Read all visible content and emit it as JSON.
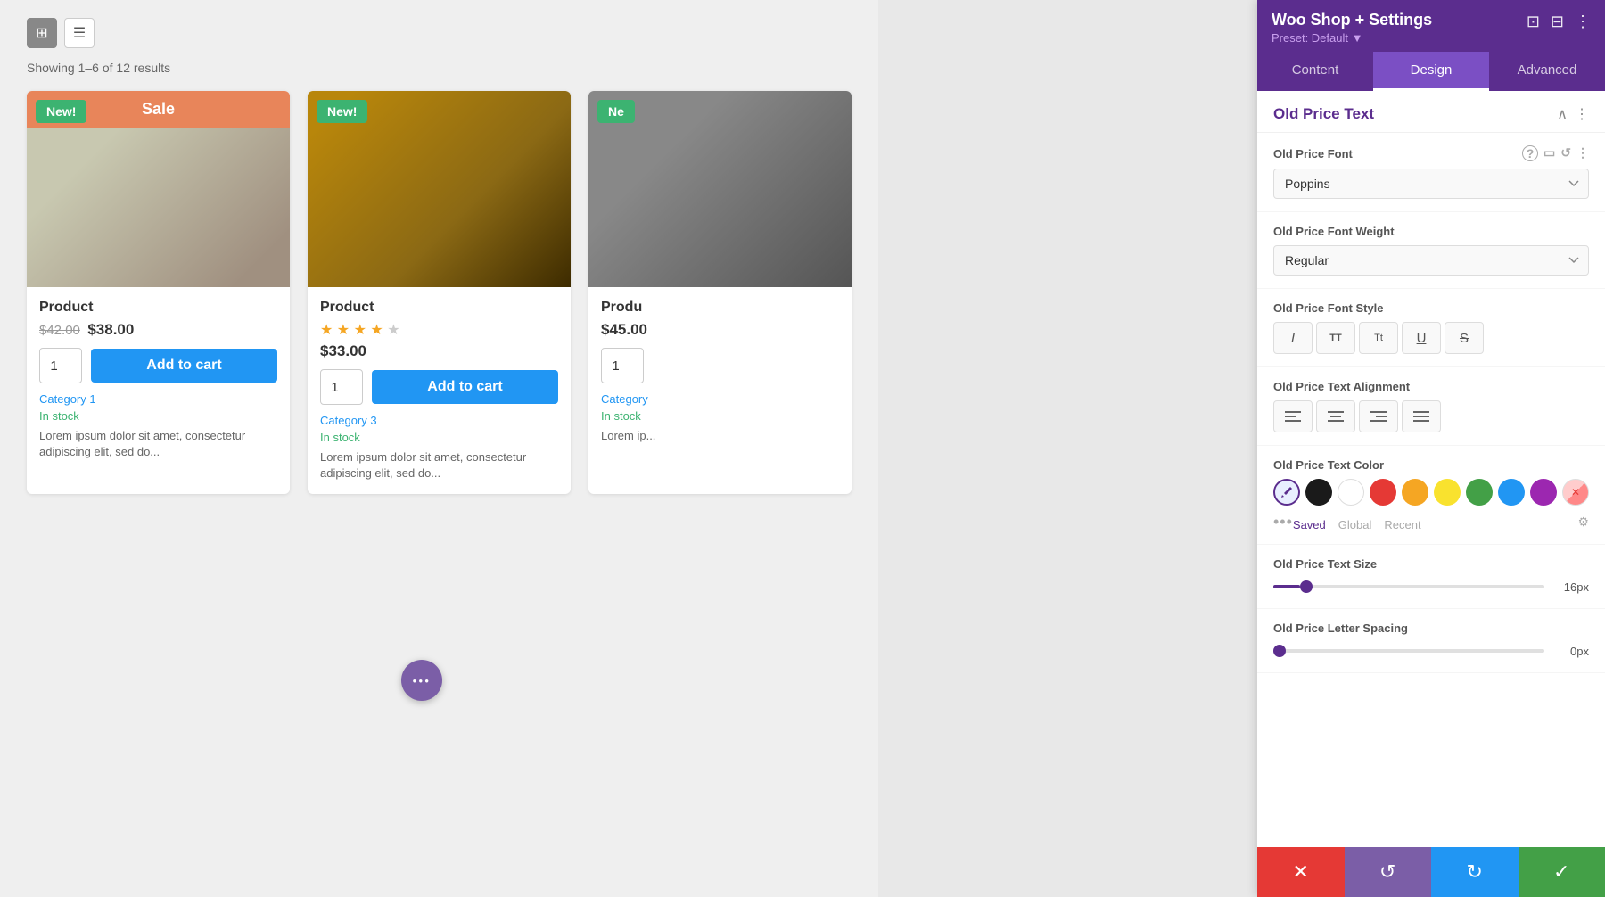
{
  "panel": {
    "title": "Woo Shop + Settings",
    "preset": "Preset: Default",
    "preset_arrow": "▼",
    "tabs": [
      {
        "id": "content",
        "label": "Content"
      },
      {
        "id": "design",
        "label": "Design"
      },
      {
        "id": "advanced",
        "label": "Advanced"
      }
    ],
    "active_tab": "design",
    "section": {
      "title": "Old Price Text"
    },
    "font": {
      "label": "Old Price Font",
      "value": "Poppins"
    },
    "font_weight": {
      "label": "Old Price Font Weight",
      "value": "Regular"
    },
    "font_style": {
      "label": "Old Price Font Style",
      "buttons": [
        {
          "id": "italic",
          "symbol": "I",
          "style": "italic"
        },
        {
          "id": "uppercase",
          "symbol": "TT"
        },
        {
          "id": "capitalize",
          "symbol": "Tt"
        },
        {
          "id": "underline",
          "symbol": "U"
        },
        {
          "id": "strikethrough",
          "symbol": "S"
        }
      ]
    },
    "text_alignment": {
      "label": "Old Price Text Alignment",
      "buttons": [
        {
          "id": "align-left",
          "symbol": "≡"
        },
        {
          "id": "align-center",
          "symbol": "≡"
        },
        {
          "id": "align-right",
          "symbol": "≡"
        },
        {
          "id": "align-justify",
          "symbol": "≡"
        }
      ]
    },
    "text_color": {
      "label": "Old Price Text Color",
      "swatches": [
        {
          "id": "eyedropper",
          "color": "eyedropper",
          "label": "eyedropper"
        },
        {
          "id": "black",
          "color": "#1a1a1a"
        },
        {
          "id": "white",
          "color": "#ffffff"
        },
        {
          "id": "red",
          "color": "#e53935"
        },
        {
          "id": "orange",
          "color": "#f5a623"
        },
        {
          "id": "yellow",
          "color": "#f9e22e"
        },
        {
          "id": "green",
          "color": "#43a047"
        },
        {
          "id": "blue",
          "color": "#2196f3"
        },
        {
          "id": "purple",
          "color": "#9c27b0"
        },
        {
          "id": "eraser",
          "color": "eraser"
        }
      ],
      "tabs": [
        "Saved",
        "Global",
        "Recent"
      ],
      "active_tab": "Saved"
    },
    "text_size": {
      "label": "Old Price Text Size",
      "value": "16px",
      "slider_percent": 10
    },
    "letter_spacing": {
      "label": "Old Price Letter Spacing",
      "value": "0px",
      "slider_percent": 0
    }
  },
  "products": [
    {
      "id": 1,
      "has_sale_banner": true,
      "sale_banner_text": "Sale",
      "has_new_badge": true,
      "new_badge_text": "New!",
      "name": "Product",
      "has_rating": false,
      "old_price": "$42.00",
      "new_price": "$38.00",
      "single_price": null,
      "qty": "1",
      "add_to_cart": "Add to cart",
      "category": "Category 1",
      "stock": "In stock",
      "description": "Lorem ipsum dolor sit amet, consectetur adipiscing elit, sed do..."
    },
    {
      "id": 2,
      "has_sale_banner": false,
      "sale_banner_text": null,
      "has_new_badge": true,
      "new_badge_text": "New!",
      "name": "Product",
      "has_rating": true,
      "rating": 4,
      "max_rating": 5,
      "old_price": null,
      "new_price": null,
      "single_price": "$33.00",
      "qty": "1",
      "add_to_cart": "Add to cart",
      "category": "Category 3",
      "stock": "In stock",
      "description": "Lorem ipsum dolor sit amet, consectetur adipiscing elit, sed do..."
    },
    {
      "id": 3,
      "has_sale_banner": false,
      "sale_banner_text": null,
      "has_new_badge": true,
      "new_badge_text": "Ne",
      "name": "Produ",
      "has_rating": false,
      "old_price": null,
      "new_price": null,
      "single_price": "$45.00",
      "qty": null,
      "add_to_cart": null,
      "category": "Category",
      "stock": "In stock",
      "description": "Lorem ip..."
    }
  ],
  "toolbar": {
    "grid_icon": "⊞",
    "list_icon": "☰",
    "results_text": "Showing 1–6 of 12 results"
  },
  "dots_fab_icon": "•••",
  "action_bar": {
    "cancel_icon": "✕",
    "undo_icon": "↺",
    "redo_icon": "↻",
    "confirm_icon": "✓"
  }
}
